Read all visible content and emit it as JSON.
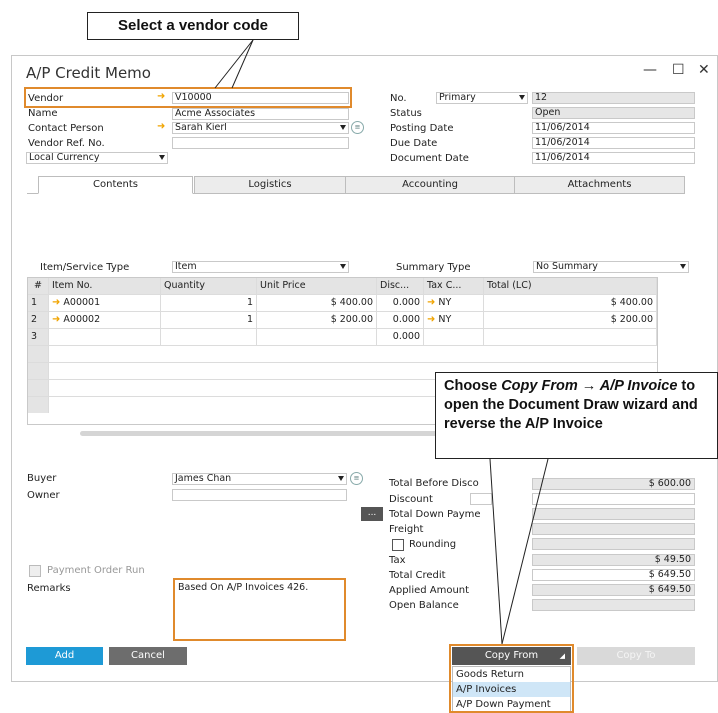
{
  "callouts": {
    "vendor": "Select a vendor code",
    "copy_pre": "Choose ",
    "copy_em": "Copy From → A/P Invoice",
    "copy_post": " to open the Document Draw wizard and reverse the A/P Invoice"
  },
  "window": {
    "title": "A/P Credit Memo",
    "min": "—",
    "max": "☐",
    "close": "✕"
  },
  "header": {
    "vendor_label": "Vendor",
    "vendor_value": "V10000",
    "name_label": "Name",
    "name_value": "Acme Associates",
    "contact_label": "Contact Person",
    "contact_value": "Sarah Kierl",
    "vendor_ref_label": "Vendor Ref. No.",
    "vendor_ref_value": "",
    "currency": "Local Currency",
    "no_label": "No.",
    "no_series": "Primary",
    "no_value": "12",
    "status_label": "Status",
    "status_value": "Open",
    "posting_label": "Posting Date",
    "posting_value": "11/06/2014",
    "due_label": "Due Date",
    "due_value": "11/06/2014",
    "doc_label": "Document Date",
    "doc_value": "11/06/2014"
  },
  "tabs": [
    "Contents",
    "Logistics",
    "Accounting",
    "Attachments"
  ],
  "contents": {
    "item_type_label": "Item/Service Type",
    "item_type_value": "Item",
    "summary_label": "Summary Type",
    "summary_value": "No Summary",
    "columns": [
      "#",
      "Item No.",
      "Quantity",
      "Unit Price",
      "Disc...",
      "Tax C...",
      "Total (LC)"
    ],
    "rows": [
      {
        "num": "1",
        "item": "A00001",
        "qty": "1",
        "price": "$ 400.00",
        "disc": "0.000",
        "tax": "NY",
        "total": "$ 400.00"
      },
      {
        "num": "2",
        "item": "A00002",
        "qty": "1",
        "price": "$ 200.00",
        "disc": "0.000",
        "tax": "NY",
        "total": "$ 200.00"
      },
      {
        "num": "3",
        "item": "",
        "qty": "",
        "price": "",
        "disc": "0.000",
        "tax": "",
        "total": ""
      }
    ]
  },
  "footer": {
    "buyer_label": "Buyer",
    "buyer_value": "James Chan",
    "owner_label": "Owner",
    "owner_value": "",
    "payment_order_label": "Payment Order Run",
    "remarks_label": "Remarks",
    "remarks_value": "Based On A/P Invoices 426.",
    "total_before_label": "Total Before Disco",
    "total_before_value": "$ 600.00",
    "discount_label": "Discount",
    "down_payment_label": "Total Down Payme",
    "freight_label": "Freight",
    "rounding_label": "Rounding",
    "tax_label": "Tax",
    "tax_value": "$ 49.50",
    "total_credit_label": "Total Credit",
    "total_credit_value": "$ 649.50",
    "applied_label": "Applied Amount",
    "applied_value": "$ 649.50",
    "open_balance_label": "Open Balance",
    "ellipsis": "..."
  },
  "buttons": {
    "add": "Add",
    "cancel": "Cancel",
    "copy_from": "Copy From",
    "copy_to": "Copy To"
  },
  "copy_menu": [
    "Goods Return",
    "A/P Invoices",
    "A/P Down Payment"
  ],
  "colors": {
    "accent": "#1e9ad6",
    "highlight": "#e08a2c",
    "arrow": "#f0a400"
  }
}
